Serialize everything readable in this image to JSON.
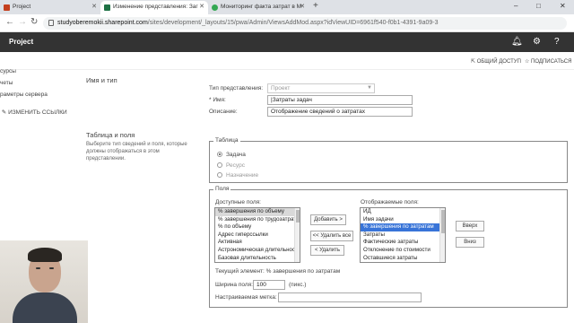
{
  "browser": {
    "tabs": [
      {
        "label": "Project",
        "active": false,
        "fav_color": "#c43e1c"
      },
      {
        "label": "Изменение представления: Заг",
        "active": true,
        "fav_color": "#1e7145"
      },
      {
        "label": "Мониторинг факта затрат в M",
        "active": false,
        "fav_color": "#34a853"
      }
    ],
    "new_tab": "+",
    "window_controls": [
      "–",
      "□",
      "✕"
    ],
    "url_host": "studyoberemokii.sharepoint.com",
    "url_path": "/sites/development/_layouts/15/pwa/Admin/ViewsAddMod.aspx?idViewUID=6961f540-f0b1-4391-9a09-3",
    "icons": {
      "back": "arrow-left-icon",
      "forward": "arrow-right-icon",
      "reload": "reload-icon",
      "lock": "lock-icon"
    }
  },
  "suitebar": {
    "title": "Project",
    "bg_color": "#333333",
    "icons": [
      "bell-icon",
      "gear-icon",
      "help-icon"
    ]
  },
  "ribbon": {
    "share": "ОБЩИЙ ДОСТУП",
    "follow": "ПОДПИСАТЬСЯ"
  },
  "leftnav": {
    "items": [
      "сурсы",
      "четы",
      "раметры сервера"
    ],
    "edit_links": "ИЗМЕНИТЬ ССЫЛКИ"
  },
  "name_type": {
    "section_title": "Имя и тип",
    "view_type_label": "Тип представления:",
    "view_type_value": "Проект",
    "name_label": "* Имя:",
    "name_value": "|Затраты задач",
    "description_label": "Описание:",
    "description_value": "Отображение сведений о затратах"
  },
  "table_fields": {
    "section_title": "Таблица и поля",
    "section_desc": "Выберите тип сведений и поля, которые должны отображаться в этом представлении.",
    "table_legend": "Таблица",
    "table_options": [
      {
        "label": "Задача",
        "selected": true
      },
      {
        "label": "Ресурс",
        "selected": false
      },
      {
        "label": "Назначение",
        "selected": false
      }
    ],
    "fields_legend": "Поля",
    "available_label": "Доступные поля:",
    "available_fields": [
      "% завершения по объему",
      "% завершения по трудозатратам",
      "% по объему",
      "Адрес гиперссылки",
      "Активная",
      "Астрономическая длительность",
      "Базовая длительность"
    ],
    "available_selected": 0,
    "displayed_label": "Отображаемые поля:",
    "displayed_fields": [
      "ИД",
      "Имя задачи",
      "% завершения по затратам",
      "Затраты",
      "Фактические затраты",
      "Отклонение по стоимости",
      "Оставшиеся затраты"
    ],
    "displayed_selected": 2,
    "btn_add": "Добавить >",
    "btn_remove_all": "<< Удалить все",
    "btn_remove": "< Удалить",
    "btn_up": "Вверх",
    "btn_down": "Вниз",
    "current_element": "Текущий элемент: % завершения по затратам",
    "width_label": "Ширина поля:",
    "width_value": "100",
    "width_unit": "(пикс.)",
    "custom_label": "Настраиваемая метка:",
    "custom_value": ""
  }
}
